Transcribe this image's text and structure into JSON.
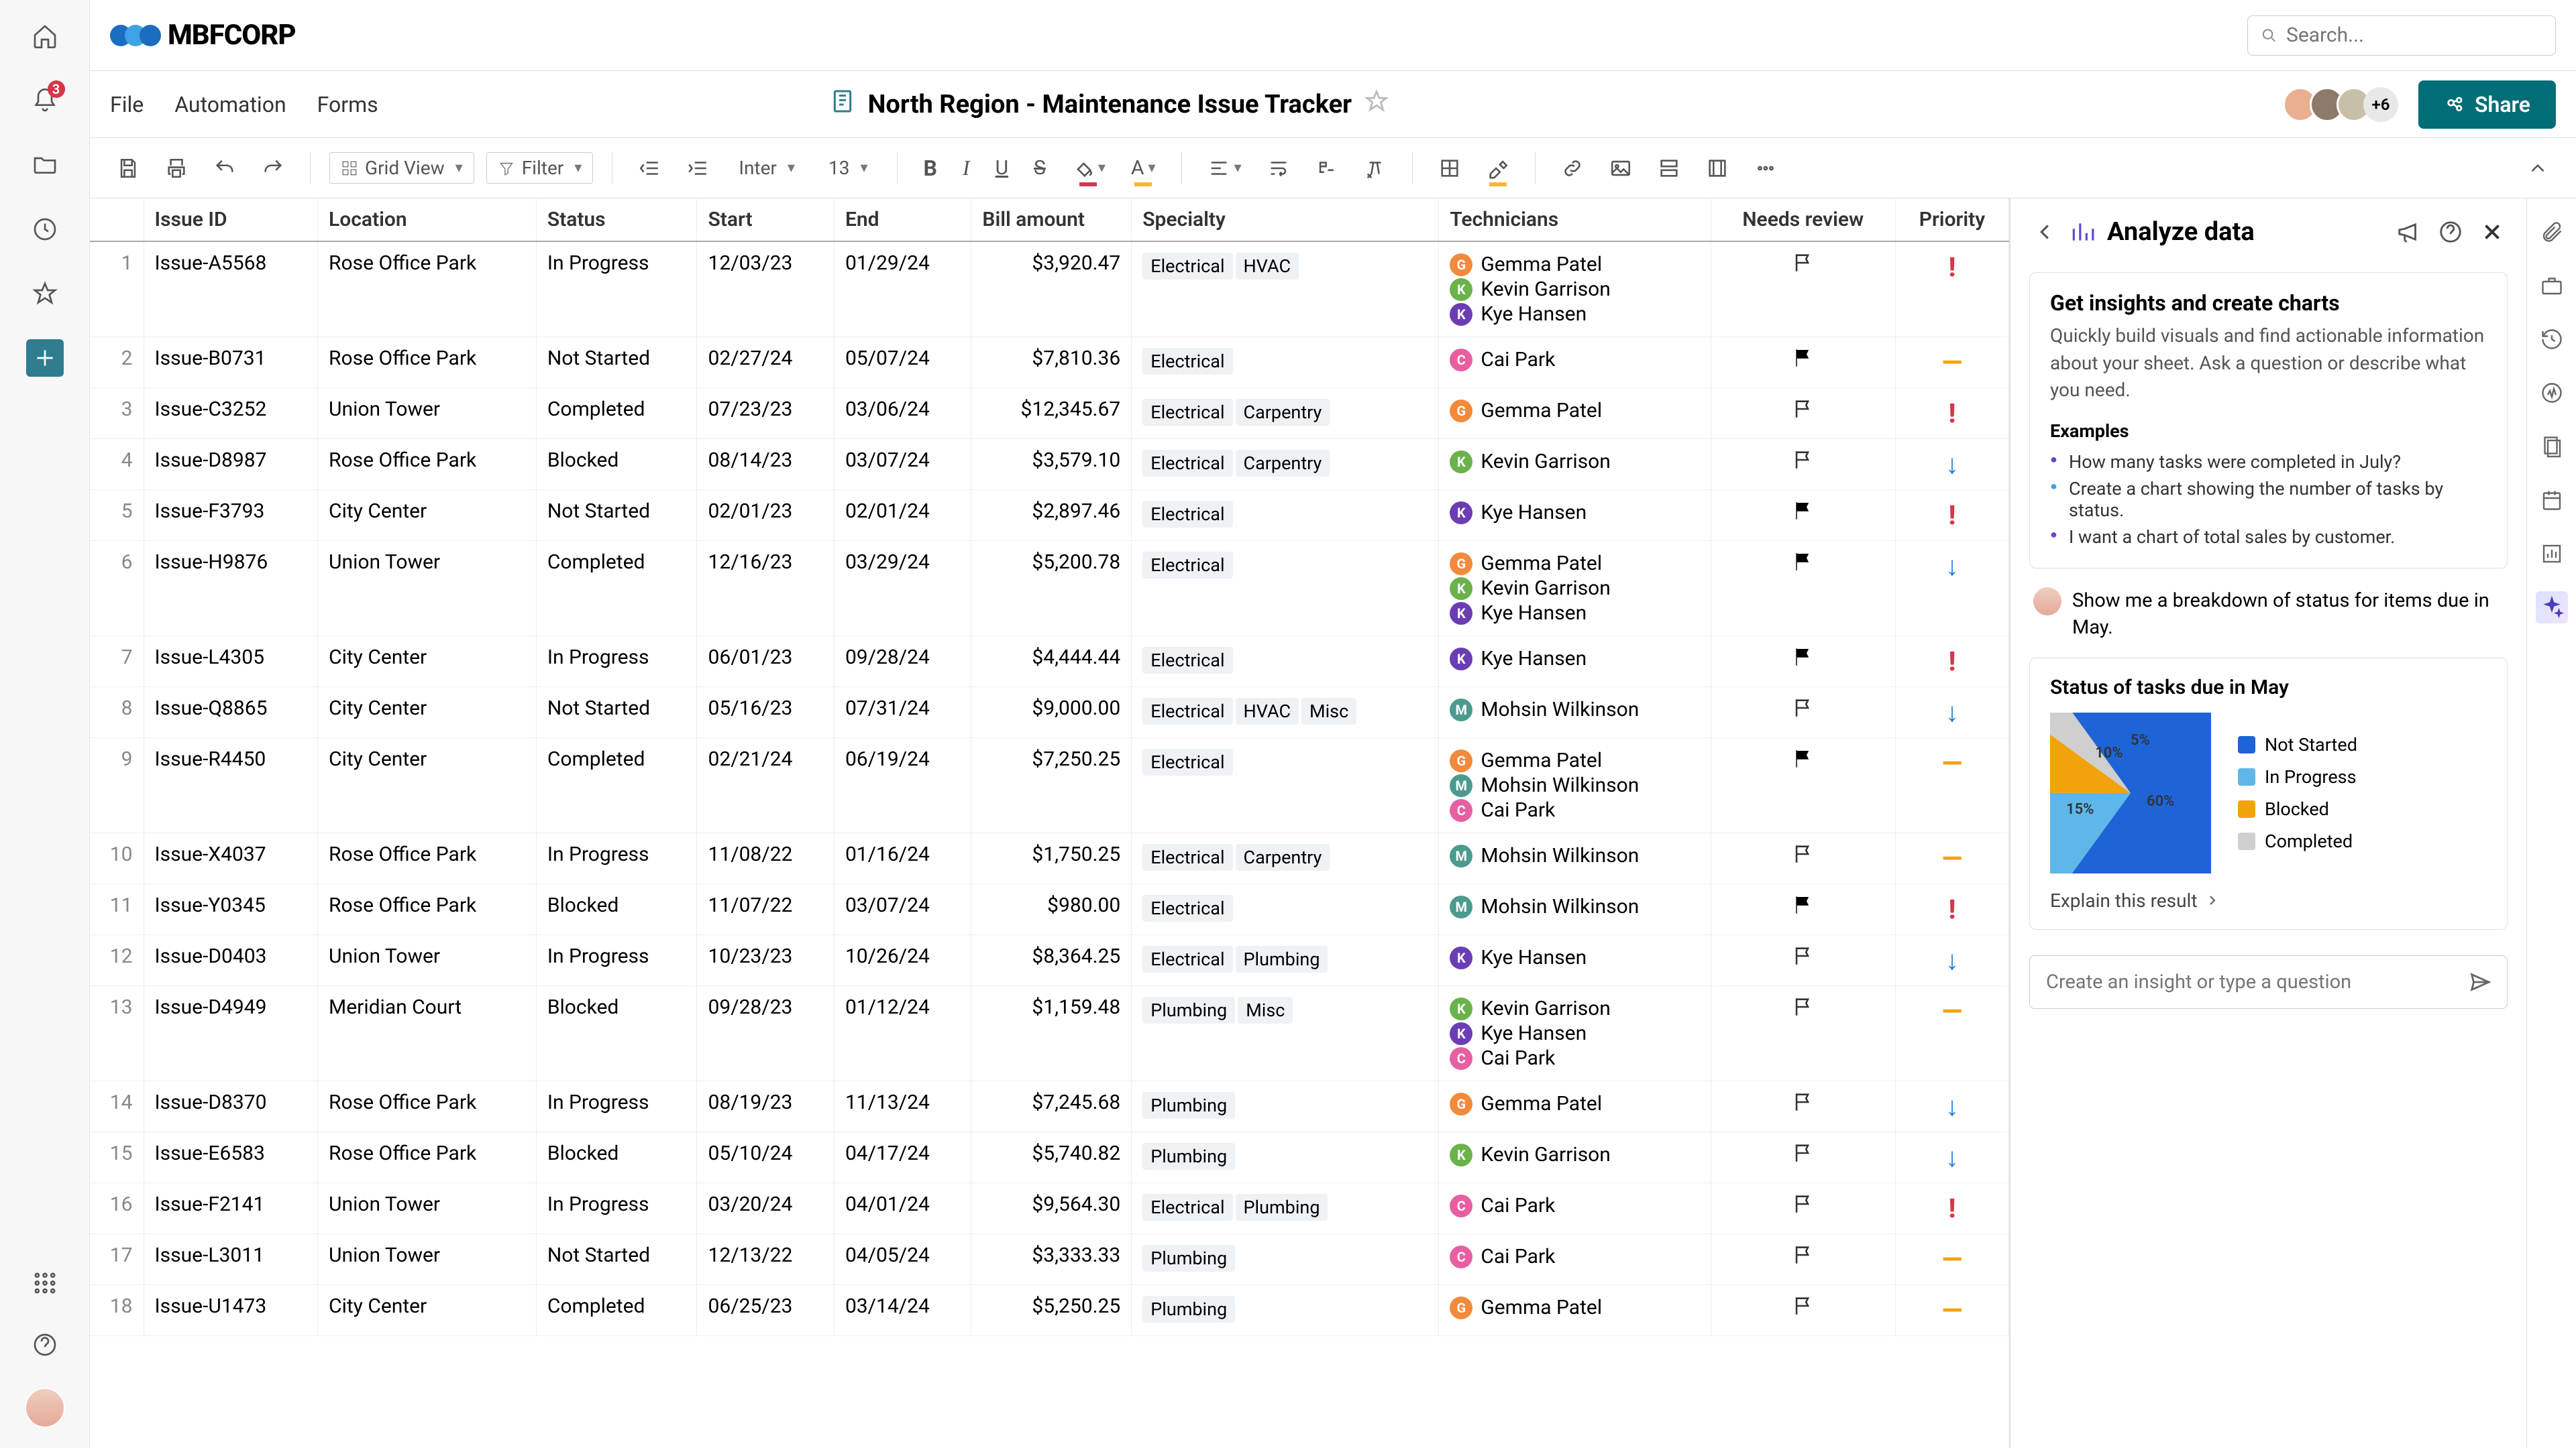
{
  "brand": "MBFCORP",
  "search_placeholder": "Search...",
  "leftRail": {
    "notifBadge": "3"
  },
  "menu": [
    "File",
    "Automation",
    "Forms"
  ],
  "doc_title": "North Region - Maintenance Issue Tracker",
  "collab_more": "+6",
  "share_label": "Share",
  "toolbar": {
    "view": "Grid View",
    "filter": "Filter",
    "font": "Inter",
    "size": "13"
  },
  "columns": [
    "Issue ID",
    "Location",
    "Status",
    "Start",
    "End",
    "Bill amount",
    "Specialty",
    "Technicians",
    "Needs review",
    "Priority"
  ],
  "tech_colors": {
    "Gemma Patel": "#f28a3c",
    "Kevin Garrison": "#6bb24b",
    "Kye Hansen": "#6a3db5",
    "Cai Park": "#e85fa1",
    "Mohsin Wilkinson": "#4a9b8e"
  },
  "rows": [
    {
      "n": 1,
      "id": "Issue-A5568",
      "loc": "Rose Office Park",
      "status": "In Progress",
      "start": "12/03/23",
      "end": "01/29/24",
      "bill": "$3,920.47",
      "spec": [
        "Electrical",
        "HVAC"
      ],
      "tech": [
        "Gemma Patel",
        "Kevin Garrison",
        "Kye Hansen"
      ],
      "flag": "out",
      "pri": "high"
    },
    {
      "n": 2,
      "id": "Issue-B0731",
      "loc": "Rose Office Park",
      "status": "Not Started",
      "start": "02/27/24",
      "end": "05/07/24",
      "bill": "$7,810.36",
      "spec": [
        "Electrical"
      ],
      "tech": [
        "Cai Park"
      ],
      "flag": "fill",
      "pri": "med"
    },
    {
      "n": 3,
      "id": "Issue-C3252",
      "loc": "Union Tower",
      "status": "Completed",
      "start": "07/23/23",
      "end": "03/06/24",
      "bill": "$12,345.67",
      "spec": [
        "Electrical",
        "Carpentry"
      ],
      "tech": [
        "Gemma Patel"
      ],
      "flag": "out",
      "pri": "high"
    },
    {
      "n": 4,
      "id": "Issue-D8987",
      "loc": "Rose Office Park",
      "status": "Blocked",
      "start": "08/14/23",
      "end": "03/07/24",
      "bill": "$3,579.10",
      "spec": [
        "Electrical",
        "Carpentry"
      ],
      "tech": [
        "Kevin Garrison"
      ],
      "flag": "out",
      "pri": "low"
    },
    {
      "n": 5,
      "id": "Issue-F3793",
      "loc": "City Center",
      "status": "Not Started",
      "start": "02/01/23",
      "end": "02/01/24",
      "bill": "$2,897.46",
      "spec": [
        "Electrical"
      ],
      "tech": [
        "Kye Hansen"
      ],
      "flag": "fill",
      "pri": "high"
    },
    {
      "n": 6,
      "id": "Issue-H9876",
      "loc": "Union Tower",
      "status": "Completed",
      "start": "12/16/23",
      "end": "03/29/24",
      "bill": "$5,200.78",
      "spec": [
        "Electrical"
      ],
      "tech": [
        "Gemma Patel",
        "Kevin Garrison",
        "Kye Hansen"
      ],
      "flag": "fill",
      "pri": "low"
    },
    {
      "n": 7,
      "id": "Issue-L4305",
      "loc": "City Center",
      "status": "In Progress",
      "start": "06/01/23",
      "end": "09/28/24",
      "bill": "$4,444.44",
      "spec": [
        "Electrical"
      ],
      "tech": [
        "Kye Hansen"
      ],
      "flag": "fill",
      "pri": "high"
    },
    {
      "n": 8,
      "id": "Issue-Q8865",
      "loc": "City Center",
      "status": "Not Started",
      "start": "05/16/23",
      "end": "07/31/24",
      "bill": "$9,000.00",
      "spec": [
        "Electrical",
        "HVAC",
        "Misc"
      ],
      "tech": [
        "Mohsin Wilkinson"
      ],
      "flag": "out",
      "pri": "low"
    },
    {
      "n": 9,
      "id": "Issue-R4450",
      "loc": "City Center",
      "status": "Completed",
      "start": "02/21/24",
      "end": "06/19/24",
      "bill": "$7,250.25",
      "spec": [
        "Electrical"
      ],
      "tech": [
        "Gemma Patel",
        "Mohsin Wilkinson",
        "Cai Park"
      ],
      "flag": "fill",
      "pri": "med"
    },
    {
      "n": 10,
      "id": "Issue-X4037",
      "loc": "Rose Office Park",
      "status": "In Progress",
      "start": "11/08/22",
      "end": "01/16/24",
      "bill": "$1,750.25",
      "spec": [
        "Electrical",
        "Carpentry"
      ],
      "tech": [
        "Mohsin Wilkinson"
      ],
      "flag": "out",
      "pri": "med"
    },
    {
      "n": 11,
      "id": "Issue-Y0345",
      "loc": "Rose Office Park",
      "status": "Blocked",
      "start": "11/07/22",
      "end": "03/07/24",
      "bill": "$980.00",
      "spec": [
        "Electrical"
      ],
      "tech": [
        "Mohsin Wilkinson"
      ],
      "flag": "fill",
      "pri": "high"
    },
    {
      "n": 12,
      "id": "Issue-D0403",
      "loc": "Union Tower",
      "status": "In Progress",
      "start": "10/23/23",
      "end": "10/26/24",
      "bill": "$8,364.25",
      "spec": [
        "Electrical",
        "Plumbing"
      ],
      "tech": [
        "Kye Hansen"
      ],
      "flag": "out",
      "pri": "low"
    },
    {
      "n": 13,
      "id": "Issue-D4949",
      "loc": "Meridian Court",
      "status": "Blocked",
      "start": "09/28/23",
      "end": "01/12/24",
      "bill": "$1,159.48",
      "spec": [
        "Plumbing",
        "Misc"
      ],
      "tech": [
        "Kevin Garrison",
        "Kye Hansen",
        "Cai Park"
      ],
      "flag": "out",
      "pri": "med"
    },
    {
      "n": 14,
      "id": "Issue-D8370",
      "loc": "Rose Office Park",
      "status": "In Progress",
      "start": "08/19/23",
      "end": "11/13/24",
      "bill": "$7,245.68",
      "spec": [
        "Plumbing"
      ],
      "tech": [
        "Gemma Patel"
      ],
      "flag": "out",
      "pri": "low"
    },
    {
      "n": 15,
      "id": "Issue-E6583",
      "loc": "Rose Office Park",
      "status": "Blocked",
      "start": "05/10/24",
      "end": "04/17/24",
      "bill": "$5,740.82",
      "spec": [
        "Plumbing"
      ],
      "tech": [
        "Kevin Garrison"
      ],
      "flag": "out",
      "pri": "low"
    },
    {
      "n": 16,
      "id": "Issue-F2141",
      "loc": "Union Tower",
      "status": "In Progress",
      "start": "03/20/24",
      "end": "04/01/24",
      "bill": "$9,564.30",
      "spec": [
        "Electrical",
        "Plumbing"
      ],
      "tech": [
        "Cai Park"
      ],
      "flag": "out",
      "pri": "high"
    },
    {
      "n": 17,
      "id": "Issue-L3011",
      "loc": "Union Tower",
      "status": "Not Started",
      "start": "12/13/22",
      "end": "04/05/24",
      "bill": "$3,333.33",
      "spec": [
        "Plumbing"
      ],
      "tech": [
        "Cai Park"
      ],
      "flag": "out",
      "pri": "med"
    },
    {
      "n": 18,
      "id": "Issue-U1473",
      "loc": "City Center",
      "status": "Completed",
      "start": "06/25/23",
      "end": "03/14/24",
      "bill": "$5,250.25",
      "spec": [
        "Plumbing"
      ],
      "tech": [
        "Gemma Patel"
      ],
      "flag": "out",
      "pri": "med"
    }
  ],
  "panel": {
    "title": "Analyze data",
    "card_title": "Get insights and create charts",
    "card_body": "Quickly build visuals and find actionable information about your sheet. Ask a question or describe what you need.",
    "examples_label": "Examples",
    "examples": [
      "How many tasks were completed in July?",
      "Create a chart showing the number of tasks by status.",
      "I want a chart of total sales by customer."
    ],
    "user_msg": "Show me a breakdown of status for items due in May.",
    "chart_title": "Status of tasks due in May",
    "explain": "Explain this result",
    "input_placeholder": "Create an insight or type a question"
  },
  "chart_data": {
    "type": "pie",
    "title": "Status of tasks due in May",
    "series": [
      {
        "name": "Not Started",
        "value": 60,
        "color": "#1e64d6"
      },
      {
        "name": "In Progress",
        "value": 15,
        "color": "#5fb6e8"
      },
      {
        "name": "Blocked",
        "value": 10,
        "color": "#f2a30a"
      },
      {
        "name": "Completed",
        "value": 5,
        "color": "#cfcfcf"
      }
    ],
    "labels_shown": [
      "60%",
      "15%",
      "10%",
      "5%"
    ]
  }
}
